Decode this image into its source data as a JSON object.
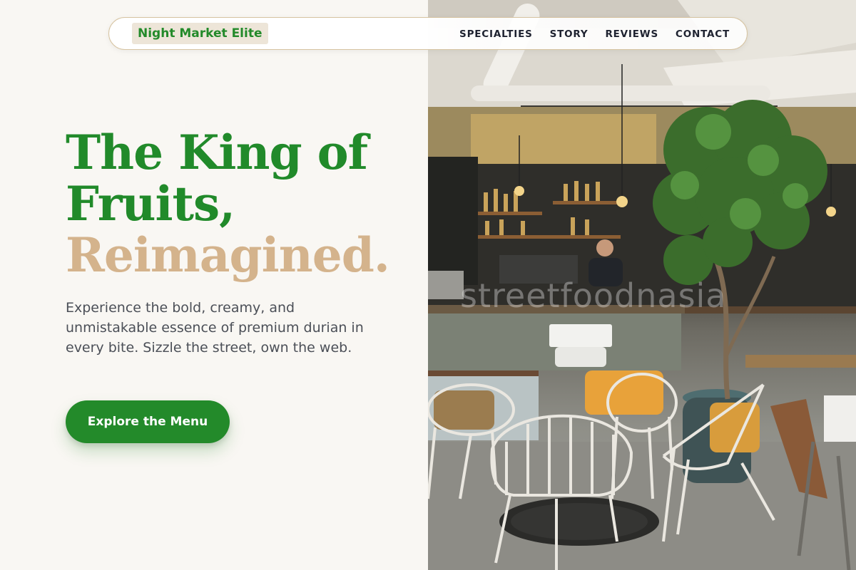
{
  "brand": {
    "logo_text": "Night Market Elite"
  },
  "nav": {
    "links": [
      {
        "label": "SPECIALTIES"
      },
      {
        "label": "STORY"
      },
      {
        "label": "REVIEWS"
      },
      {
        "label": "CONTACT"
      }
    ]
  },
  "hero": {
    "headline_line1": "The King of",
    "headline_line2": "Fruits,",
    "headline_line3": "Reimagined.",
    "description": "Experience the bold, creamy, and unmistakable essence of premium durian in every bite. Sizzle the street, own the web.",
    "cta_label": "Explore the Menu"
  },
  "photo": {
    "subject": "cafe-interior-photo",
    "watermark_text": "streetfoodnasia"
  },
  "colors": {
    "brand_green": "#238a2a",
    "accent_tan": "#d4b38c",
    "page_background": "#f9f7f3",
    "nav_text": "#1e2230",
    "body_text": "#4b4f57"
  }
}
